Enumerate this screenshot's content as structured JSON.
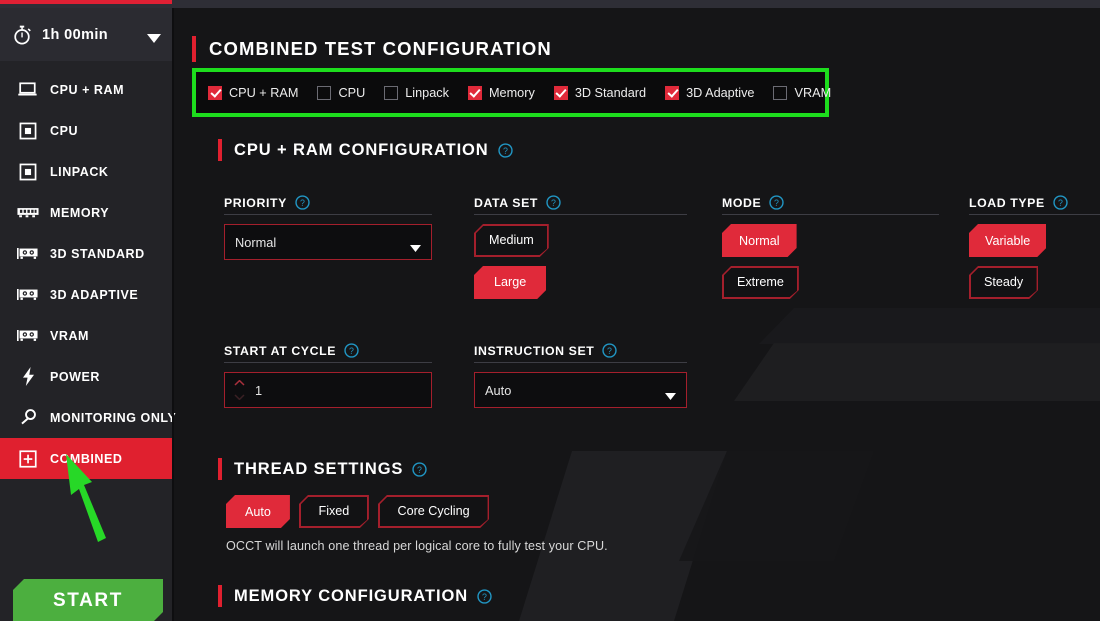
{
  "colors": {
    "accent_red": "#e0202f",
    "highlight_green": "#1ddd1d",
    "start_green": "#4caf3f",
    "help_blue": "#2196c4",
    "sidebar_bg": "#232327",
    "main_bg": "#151517"
  },
  "sidebar": {
    "timer": {
      "label": "1h 00min",
      "icon": "stopwatch-icon",
      "caret": "chevron-down-icon"
    },
    "items": [
      {
        "label": "CPU + RAM",
        "icon": "laptop-icon",
        "active": false
      },
      {
        "label": "CPU",
        "icon": "cpu-chip-icon",
        "active": false
      },
      {
        "label": "LINPACK",
        "icon": "cpu-chip-icon",
        "active": false
      },
      {
        "label": "MEMORY",
        "icon": "ram-stick-icon",
        "active": false
      },
      {
        "label": "3D STANDARD",
        "icon": "gpu-card-icon",
        "active": false
      },
      {
        "label": "3D ADAPTIVE",
        "icon": "gpu-card-icon",
        "active": false
      },
      {
        "label": "VRAM",
        "icon": "gpu-card-icon",
        "active": false
      },
      {
        "label": "POWER",
        "icon": "lightning-icon",
        "active": false
      },
      {
        "label": "MONITORING ONLY",
        "icon": "magnifier-icon",
        "active": false
      },
      {
        "label": "COMBINED",
        "icon": "plus-square-icon",
        "active": true
      }
    ],
    "start_button": {
      "label": "START"
    }
  },
  "main": {
    "page_title": "COMBINED TEST CONFIGURATION",
    "test_checkboxes": [
      {
        "label": "CPU + RAM",
        "checked": true
      },
      {
        "label": "CPU",
        "checked": false
      },
      {
        "label": "Linpack",
        "checked": false
      },
      {
        "label": "Memory",
        "checked": true
      },
      {
        "label": "3D Standard",
        "checked": true
      },
      {
        "label": "3D Adaptive",
        "checked": true
      },
      {
        "label": "VRAM",
        "checked": false
      }
    ],
    "cpu_ram_section": {
      "title": "CPU + RAM CONFIGURATION",
      "priority": {
        "label": "PRIORITY",
        "value": "Normal"
      },
      "data_set": {
        "label": "DATA SET",
        "options": [
          {
            "label": "Medium",
            "selected": false
          },
          {
            "label": "Large",
            "selected": true
          }
        ]
      },
      "mode": {
        "label": "MODE",
        "options": [
          {
            "label": "Normal",
            "selected": true
          },
          {
            "label": "Extreme",
            "selected": false
          }
        ]
      },
      "load_type": {
        "label": "LOAD TYPE",
        "options": [
          {
            "label": "Variable",
            "selected": true
          },
          {
            "label": "Steady",
            "selected": false
          }
        ]
      },
      "start_at_cycle": {
        "label": "START AT CYCLE",
        "value": "1"
      },
      "instruction_set": {
        "label": "INSTRUCTION SET",
        "value": "Auto"
      }
    },
    "thread_settings": {
      "title": "THREAD SETTINGS",
      "options": [
        {
          "label": "Auto",
          "selected": true
        },
        {
          "label": "Fixed",
          "selected": false
        },
        {
          "label": "Core Cycling",
          "selected": false
        }
      ],
      "hint": "OCCT will launch one thread per logical core to fully test your CPU."
    },
    "memory_section": {
      "title": "MEMORY CONFIGURATION"
    }
  }
}
